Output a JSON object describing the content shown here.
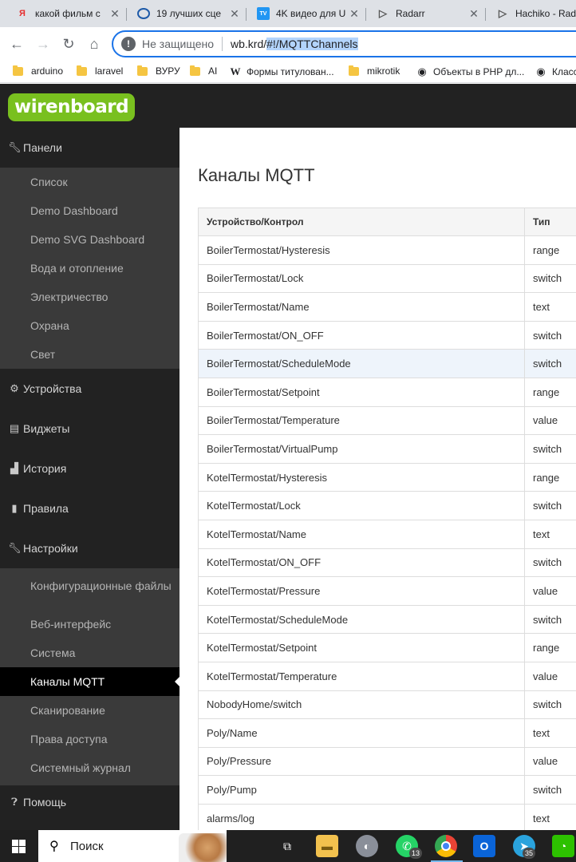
{
  "browser": {
    "tabs": [
      {
        "icon": "yandex-icon",
        "title": "какой фильм с"
      },
      {
        "icon": "circle-c-icon",
        "title": "19 лучших сце"
      },
      {
        "icon": "tv-icon",
        "title": "4K видео для U"
      },
      {
        "icon": "play-icon",
        "title": "Radarr"
      },
      {
        "icon": "play-icon",
        "title": "Hachiko - Rada"
      }
    ],
    "address": {
      "security": "Не защищено",
      "host": "wb.krd/",
      "path": "#!/MQTTChannels"
    },
    "bookmarks": [
      {
        "icon": "folder-icon",
        "label": "arduino"
      },
      {
        "icon": "folder-icon",
        "label": "laravel"
      },
      {
        "icon": "folder-icon",
        "label": "ВУРУ"
      },
      {
        "icon": "folder-icon",
        "label": "AI"
      },
      {
        "icon": "wikipedia-icon",
        "label": "Формы титулован..."
      },
      {
        "icon": "folder-icon",
        "label": "mikrotik"
      },
      {
        "icon": "github-icon",
        "label": "Объекты в PHP дл..."
      },
      {
        "icon": "github-icon",
        "label": "Класс"
      }
    ]
  },
  "app": {
    "logo": "wirenboard",
    "brand_color": "#79c01f"
  },
  "sidebar": {
    "panels": {
      "label": "Панели",
      "icon": "wrench-icon"
    },
    "panel_items": [
      "Список",
      "Demo Dashboard",
      "Demo SVG Dashboard",
      "Вода и отопление",
      "Электричество",
      "Охрана",
      "Свет"
    ],
    "devices": {
      "label": "Устройства",
      "icon": "gear-icon"
    },
    "widgets": {
      "label": "Виджеты",
      "icon": "list-icon"
    },
    "history": {
      "label": "История",
      "icon": "bar-chart-icon"
    },
    "rules": {
      "label": "Правила",
      "icon": "file-icon"
    },
    "settings": {
      "label": "Настройки",
      "icon": "wrench-icon"
    },
    "settings_items": [
      "Конфигурационные файлы",
      "Веб-интерфейс",
      "Система",
      "Каналы MQTT",
      "Сканирование",
      "Права доступа",
      "Системный журнал"
    ],
    "active_item": "Каналы MQTT",
    "help": {
      "label": "Помощь",
      "icon": "question-icon"
    }
  },
  "main": {
    "title": "Каналы MQTT",
    "columns": [
      "Устройство/Контрол",
      "Тип"
    ],
    "rows": [
      [
        "BoilerTermostat/Hysteresis",
        "range"
      ],
      [
        "BoilerTermostat/Lock",
        "switch"
      ],
      [
        "BoilerTermostat/Name",
        "text"
      ],
      [
        "BoilerTermostat/ON_OFF",
        "switch"
      ],
      [
        "BoilerTermostat/ScheduleMode",
        "switch"
      ],
      [
        "BoilerTermostat/Setpoint",
        "range"
      ],
      [
        "BoilerTermostat/Temperature",
        "value"
      ],
      [
        "BoilerTermostat/VirtualPump",
        "switch"
      ],
      [
        "KotelTermostat/Hysteresis",
        "range"
      ],
      [
        "KotelTermostat/Lock",
        "switch"
      ],
      [
        "KotelTermostat/Name",
        "text"
      ],
      [
        "KotelTermostat/ON_OFF",
        "switch"
      ],
      [
        "KotelTermostat/Pressure",
        "value"
      ],
      [
        "KotelTermostat/ScheduleMode",
        "switch"
      ],
      [
        "KotelTermostat/Setpoint",
        "range"
      ],
      [
        "KotelTermostat/Temperature",
        "value"
      ],
      [
        "NobodyHome/switch",
        "switch"
      ],
      [
        "Poly/Name",
        "text"
      ],
      [
        "Poly/Pressure",
        "value"
      ],
      [
        "Poly/Pump",
        "switch"
      ],
      [
        "alarms/log",
        "text"
      ]
    ],
    "highlighted_row": 4
  },
  "taskbar": {
    "search_label": "Поиск",
    "badges": {
      "whatsapp": "13",
      "telegram": "35"
    }
  }
}
